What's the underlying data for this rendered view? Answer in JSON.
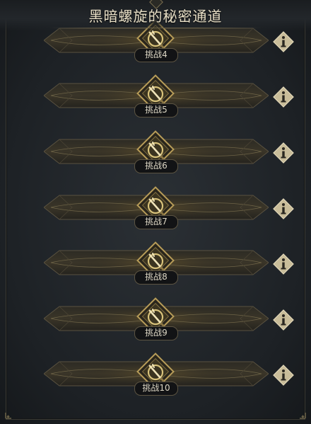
{
  "title": "黑暗螺旋的秘密通道",
  "challenges": [
    {
      "label": "挑战4"
    },
    {
      "label": "挑战5"
    },
    {
      "label": "挑战6"
    },
    {
      "label": "挑战7"
    },
    {
      "label": "挑战8"
    },
    {
      "label": "挑战9"
    },
    {
      "label": "挑战10"
    }
  ],
  "colors": {
    "background": "#1e2226",
    "gold": "#b79c58",
    "title_text": "#e8dfc6",
    "info_button": "#c9bd9a"
  },
  "icons": {
    "medal": "crossed-swords-shield-icon",
    "info": "info-icon"
  }
}
